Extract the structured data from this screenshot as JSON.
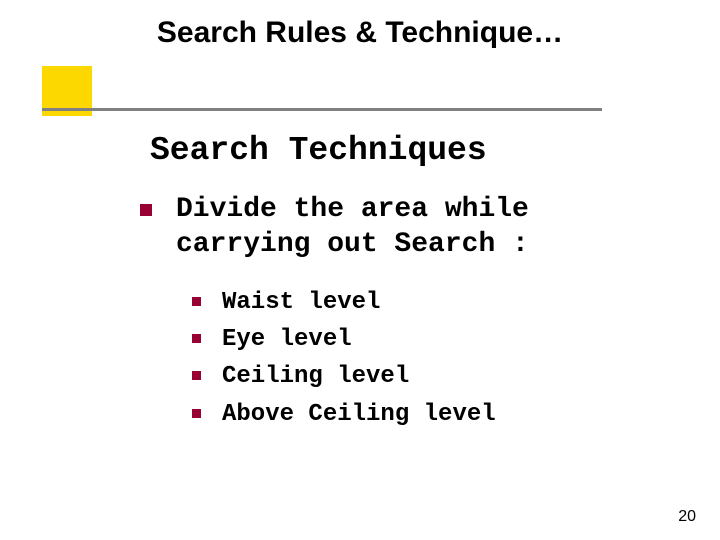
{
  "header": {
    "title": "Search Rules & Technique…"
  },
  "subtitle": "Search Techniques",
  "main": {
    "lead": "Divide the area while carrying out Search :",
    "items": [
      "Waist level",
      "Eye level",
      "Ceiling level",
      "Above Ceiling level"
    ]
  },
  "slide_number": "20"
}
